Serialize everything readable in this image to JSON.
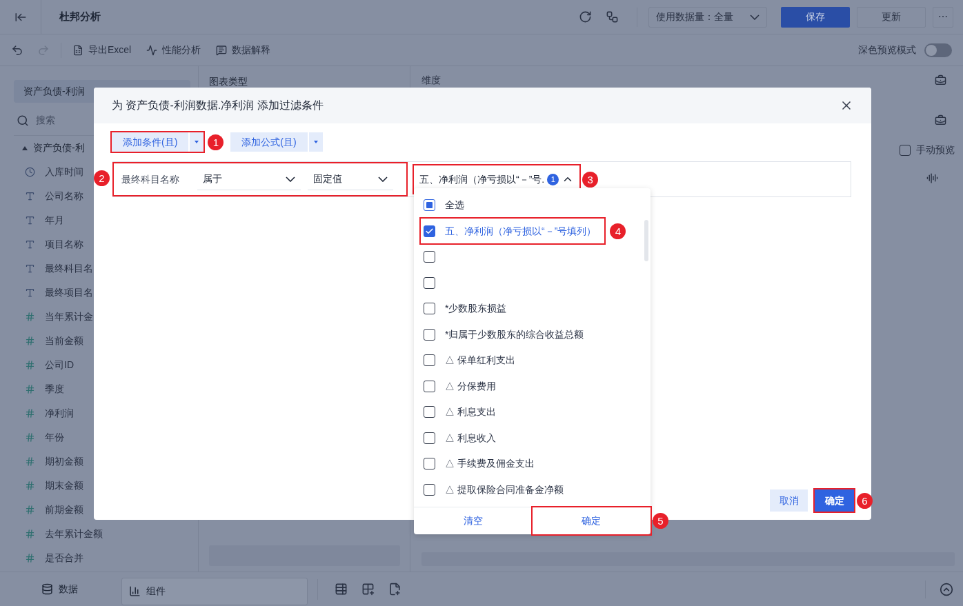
{
  "topbar": {
    "title": "杜邦分析",
    "data_select": "使用数据量：全量",
    "save": "保存",
    "update": "更新",
    "more": "⋯"
  },
  "toolbar": {
    "redo_disabled": true,
    "actions": [
      {
        "kind": "excel",
        "label": "导出Excel"
      },
      {
        "kind": "performance",
        "label": "性能分析"
      },
      {
        "kind": "explain",
        "label": "数据解释"
      }
    ],
    "dark_preview": {
      "label": "深色预览模式",
      "on": false
    }
  },
  "sidebar": {
    "dataset": "资产负债-利润",
    "search_placeholder": "搜索",
    "folder": "资产负债-利",
    "fields": [
      {
        "kind": "time",
        "label": "入库时间"
      },
      {
        "kind": "text",
        "label": "公司名称"
      },
      {
        "kind": "text",
        "label": "年月"
      },
      {
        "kind": "text",
        "label": "项目名称"
      },
      {
        "kind": "text",
        "label": "最终科目名"
      },
      {
        "kind": "text",
        "label": "最终项目名"
      },
      {
        "kind": "number",
        "label": "当年累计金"
      },
      {
        "kind": "number",
        "label": "当前金额"
      },
      {
        "kind": "number",
        "label": "公司ID"
      },
      {
        "kind": "number",
        "label": "季度"
      },
      {
        "kind": "number",
        "label": "净利润"
      },
      {
        "kind": "number",
        "label": "年份"
      },
      {
        "kind": "number",
        "label": "期初金额"
      },
      {
        "kind": "number",
        "label": "期末金额"
      },
      {
        "kind": "number",
        "label": "前期金额"
      },
      {
        "kind": "number",
        "label": "去年累计金额"
      },
      {
        "kind": "number",
        "label": "是否合并"
      }
    ]
  },
  "chart_panel": {
    "title": "图表类型"
  },
  "right_panel": {
    "dimension_label": "维度",
    "manual_preview": {
      "label": "手动预览",
      "checked": false
    }
  },
  "bottom_tabs": [
    {
      "kind": "data",
      "label": "数据",
      "selected": false
    },
    {
      "kind": "component",
      "label": "组件",
      "selected": true
    }
  ],
  "dialog": {
    "title": "为 资产负债-利润数据.净利润 添加过滤条件",
    "add_buttons": [
      {
        "label": "添加条件(且)",
        "callout": "1"
      },
      {
        "label": "添加公式(且)"
      }
    ],
    "condition": {
      "callout": "2",
      "field": "最终科目名称",
      "operator": "属于",
      "value_type": "固定值"
    },
    "value": {
      "callout": "3",
      "text": "五、净利润（净亏损以“－”号.",
      "count": "1",
      "expanded": true
    },
    "options": [
      {
        "label": "全选",
        "checked": false,
        "indeterminate": true
      },
      {
        "label": "五、净利润（净亏损以“－”号填列）",
        "checked": true,
        "callout": "4"
      },
      {
        "checked": false
      },
      {
        "checked": false
      },
      {
        "label": "*少数股东损益",
        "checked": false
      },
      {
        "label": "*归属于少数股东的综合收益总额",
        "checked": false
      },
      {
        "label": "△ 保单红利支出",
        "checked": false
      },
      {
        "label": "△ 分保费用",
        "checked": false
      },
      {
        "label": "△ 利息支出",
        "checked": false
      },
      {
        "label": "△ 利息收入",
        "checked": false
      },
      {
        "label": "△ 手续费及佣金支出",
        "checked": false
      },
      {
        "label": "△ 提取保险合同准备金净额",
        "checked": false
      }
    ],
    "option_clear": {
      "label": "清空"
    },
    "option_ok": {
      "label": "确定",
      "callout": "5"
    },
    "cancel": {
      "label": "取消"
    },
    "ok": {
      "label": "确定",
      "callout": "6"
    }
  }
}
